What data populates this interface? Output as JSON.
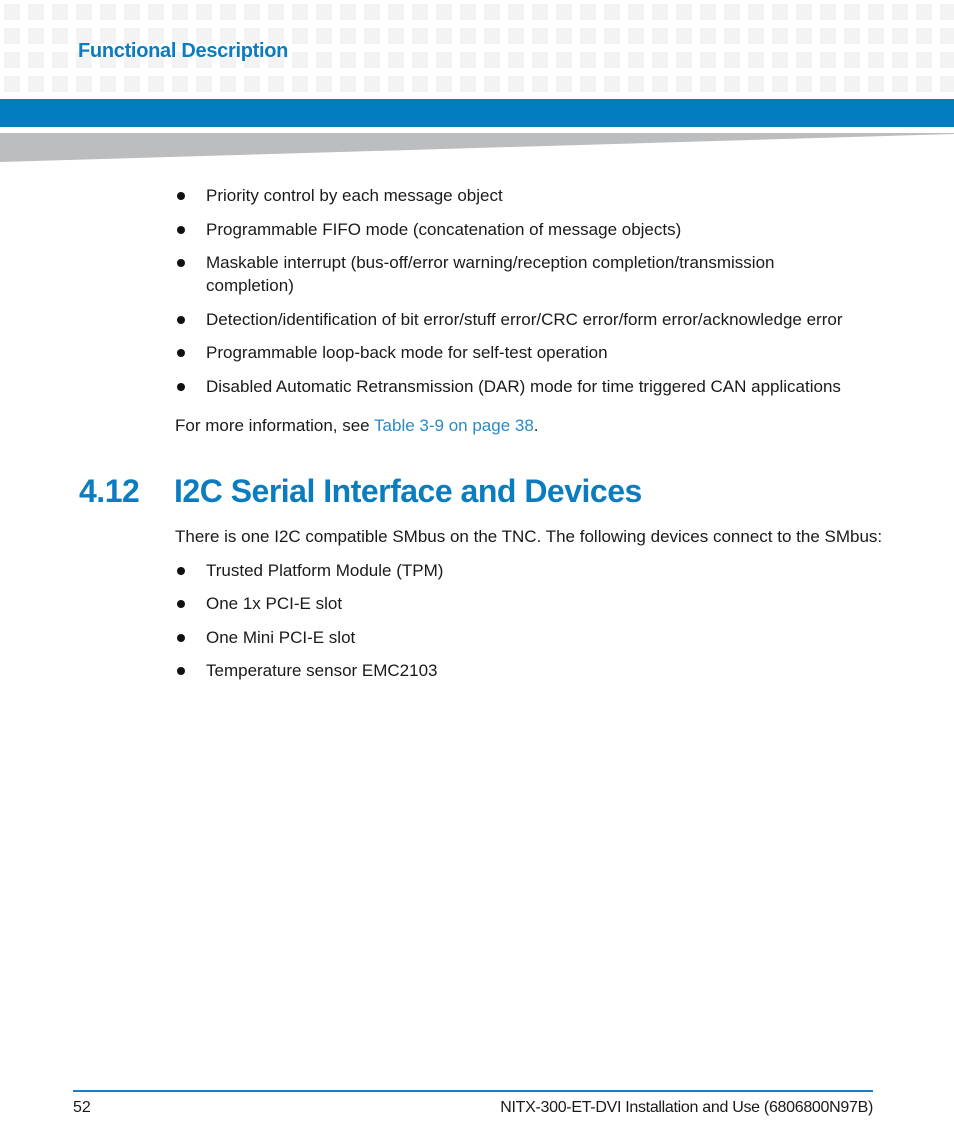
{
  "header": {
    "chapter_title": "Functional Description",
    "colors": {
      "accent": "#007cbf",
      "title": "#0a7cbf",
      "wedge": "#bcbdbf",
      "squares": "#f3f3f3"
    }
  },
  "top_list": {
    "items": [
      "Priority control by each message object",
      "Programmable FIFO mode (concatenation of message objects)",
      "Maskable interrupt (bus-off/error warning/reception completion/transmission completion)",
      "Detection/identification of bit error/stuff error/CRC error/form error/acknowledge error",
      "Programmable loop-back mode for self-test operation",
      "Disabled Automatic Retransmission (DAR) mode for time triggered CAN applications"
    ]
  },
  "more_info": {
    "prefix": "For more information, see ",
    "link_text": "Table 3-9 on page 38",
    "suffix": "."
  },
  "section": {
    "number": "4.12",
    "title": "I2C Serial Interface and Devices",
    "intro": "There is one I2C compatible SMbus on the TNC. The following devices connect to the SMbus:",
    "devices": [
      "Trusted Platform Module (TPM)",
      "One 1x PCI-E slot",
      "One Mini PCI-E slot",
      "Temperature sensor EMC2103"
    ]
  },
  "footer": {
    "page_number": "52",
    "document_title": "NITX-300-ET-DVI Installation and Use (6806800N97B)"
  }
}
